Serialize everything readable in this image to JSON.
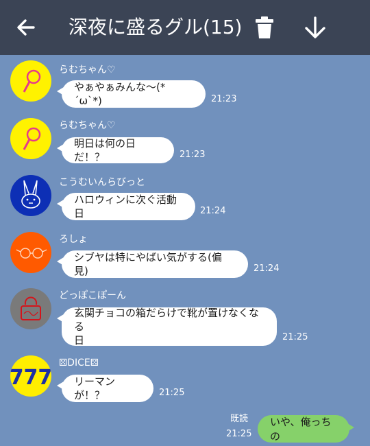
{
  "header": {
    "title": "深夜に盛るグル(15)",
    "icons": [
      "back-arrow-icon",
      "trash-icon",
      "download-arrow-icon"
    ]
  },
  "messages": [
    {
      "sender": "らむちゃん♡",
      "text": "やぁやぁみんな〜(*´ω`*)",
      "time": "21:23",
      "avatar": "yellow-lollipop"
    },
    {
      "sender": "らむちゃん♡",
      "text": "明日は何の日だ！？",
      "time": "21:23",
      "avatar": "yellow-lollipop"
    },
    {
      "sender": "こうむいんらびっと",
      "text": "ハロウィンに次ぐ活動日",
      "time": "21:24",
      "avatar": "blue-rabbit"
    },
    {
      "sender": "ろしょ",
      "text": "シブヤは特にやばい気がする(偏見)",
      "time": "21:24",
      "avatar": "orange-glasses"
    },
    {
      "sender": "どっぽこぽーん",
      "text_line1": "玄関チョコの箱だらけで靴が置けなくなる",
      "text_line2": "日",
      "time": "21:25",
      "avatar": "gray-badge"
    },
    {
      "sender": "DICE",
      "text": "リーマンが！？",
      "time": "21:25",
      "avatar": "777-logo"
    }
  ],
  "own_message": {
    "text": "いや、俺っちの",
    "read_label": "既読",
    "time": "21:25"
  },
  "colors": {
    "background": "#7191bd",
    "header": "#3b4455",
    "own_bubble": "#86d16a",
    "other_bubble": "#ffffff"
  }
}
